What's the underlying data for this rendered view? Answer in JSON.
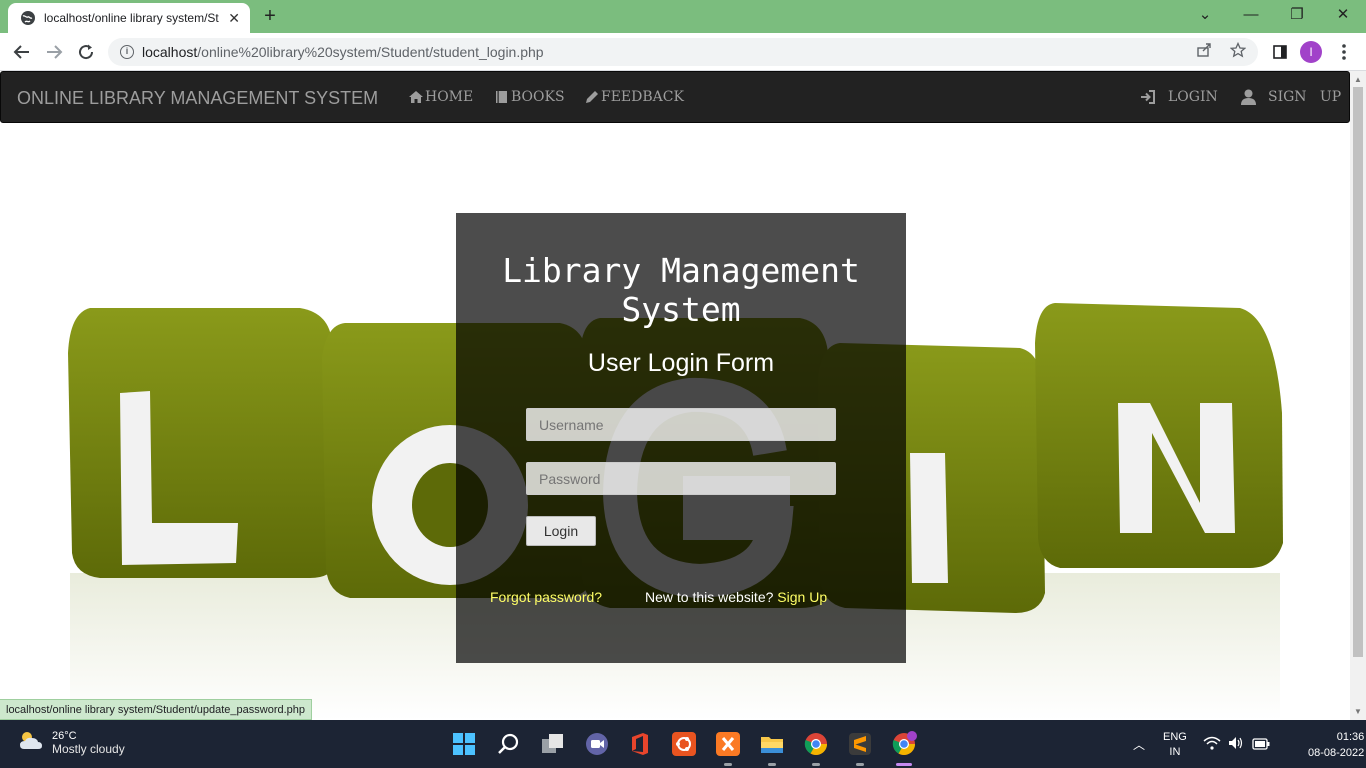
{
  "browser": {
    "tab_title": "localhost/online library system/St",
    "url_host": "localhost",
    "url_path": "/online%20library%20system/Student/student_login.php",
    "profile_initial": "I",
    "status_url": "localhost/online library system/Student/update_password.php"
  },
  "navbar": {
    "brand": "ONLINE LIBRARY MANAGEMENT SYSTEM",
    "links": [
      {
        "label": "HOME",
        "icon": "home-icon"
      },
      {
        "label": "BOOKS",
        "icon": "book-icon"
      },
      {
        "label": "FEEDBACK",
        "icon": "pencil-icon"
      }
    ],
    "right_links": [
      {
        "label": "LOGIN",
        "icon": "login-icon"
      },
      {
        "label": "SIGN   UP",
        "icon": "user-icon"
      }
    ]
  },
  "login": {
    "title": "Library Management System",
    "subtitle": "User Login Form",
    "username_placeholder": "Username",
    "password_placeholder": "Password",
    "button_label": "Login",
    "forgot_label": "Forgot password?",
    "new_site_text": "New to this website?",
    "signup_label": "Sign Up"
  },
  "taskbar": {
    "temperature": "26°C",
    "weather": "Mostly cloudy",
    "lang_top": "ENG",
    "lang_bottom": "IN",
    "time": "01:36",
    "date": "08-08-2022",
    "icons": [
      "start-icon",
      "search-icon",
      "task-view-icon",
      "meet-icon",
      "office-icon",
      "ubuntu-icon",
      "xampp-icon",
      "file-explorer-icon",
      "chrome-icon",
      "sublime-icon",
      "chrome-profile-icon"
    ]
  },
  "colors": {
    "navbar_bg": "#222222",
    "cube_green": "#6b7a0c",
    "link_yellow": "#ffff66",
    "chrome_green": "#7bbd7e"
  }
}
